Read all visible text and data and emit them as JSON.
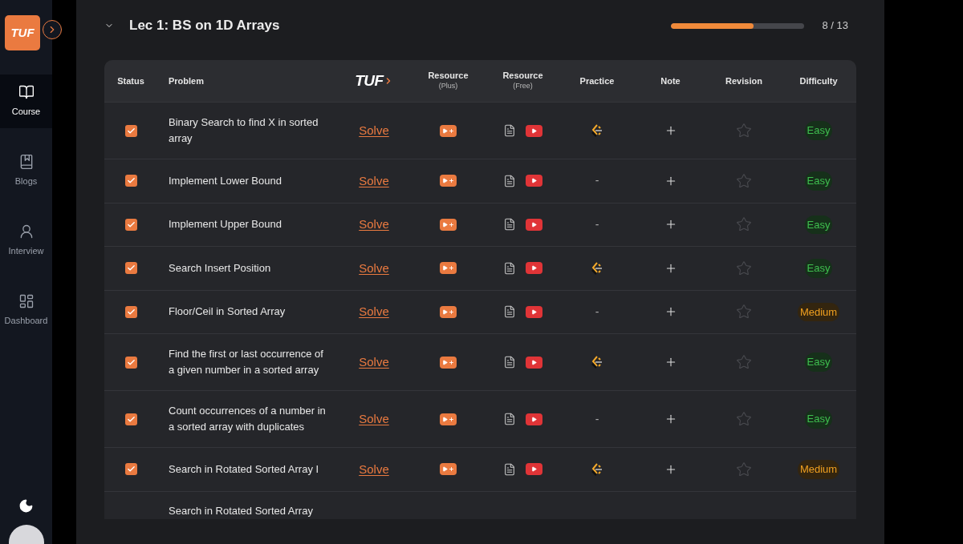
{
  "sidebar": {
    "logo": "TUF",
    "items": [
      {
        "label": "Course",
        "selected": true
      },
      {
        "label": "Blogs",
        "selected": false
      },
      {
        "label": "Interview",
        "selected": false
      },
      {
        "label": "Dashboard",
        "selected": false
      }
    ]
  },
  "lecture": {
    "title": "Lec 1: BS on 1D Arrays",
    "expanded": true,
    "progress": {
      "level": 0.615,
      "reading": "8 / 13"
    }
  },
  "table": {
    "columns": [
      {
        "kind": "text",
        "label": "Status"
      },
      {
        "kind": "text",
        "label": "Problem"
      },
      {
        "kind": "logo",
        "label": "TUF"
      },
      {
        "kind": "text",
        "label": "Resource",
        "sub": "(Plus)"
      },
      {
        "kind": "text",
        "label": "Resource",
        "sub": "(Free)"
      },
      {
        "kind": "text",
        "label": "Practice"
      },
      {
        "kind": "text",
        "label": "Note"
      },
      {
        "kind": "text",
        "label": "Revision"
      },
      {
        "kind": "text",
        "label": "Difficulty"
      }
    ],
    "rows": [
      {
        "kind": "full",
        "checked": true,
        "title": "Binary Search to find X in sorted array",
        "link": "Solve",
        "practice": {
          "kind": "icon"
        },
        "starred": false,
        "difficulty": {
          "kind": "easy",
          "label": "Easy"
        }
      },
      {
        "kind": "full",
        "checked": true,
        "title": "Implement Lower Bound",
        "link": "Solve",
        "practice": {
          "kind": "dash",
          "label": "-"
        },
        "starred": false,
        "difficulty": {
          "kind": "easy",
          "label": "Easy"
        }
      },
      {
        "kind": "full",
        "checked": true,
        "title": "Implement Upper Bound",
        "link": "Solve",
        "practice": {
          "kind": "dash",
          "label": "-"
        },
        "starred": false,
        "difficulty": {
          "kind": "easy",
          "label": "Easy"
        }
      },
      {
        "kind": "full",
        "checked": true,
        "title": "Search Insert Position",
        "link": "Solve",
        "practice": {
          "kind": "icon"
        },
        "starred": false,
        "difficulty": {
          "kind": "easy",
          "label": "Easy"
        }
      },
      {
        "kind": "full",
        "checked": true,
        "title": "Floor/Ceil in Sorted Array",
        "link": "Solve",
        "practice": {
          "kind": "dash",
          "label": "-"
        },
        "starred": false,
        "difficulty": {
          "kind": "medium",
          "label": "Medium"
        }
      },
      {
        "kind": "full",
        "checked": true,
        "title": "Find the first or last occurrence of a given number in a sorted array",
        "link": "Solve",
        "practice": {
          "kind": "icon"
        },
        "starred": false,
        "difficulty": {
          "kind": "easy",
          "label": "Easy"
        }
      },
      {
        "kind": "full",
        "checked": true,
        "title": "Count occurrences of a number in a sorted array with duplicates",
        "link": "Solve",
        "practice": {
          "kind": "dash",
          "label": "-"
        },
        "starred": false,
        "difficulty": {
          "kind": "easy",
          "label": "Easy"
        }
      },
      {
        "kind": "full",
        "checked": true,
        "title": "Search in Rotated Sorted Array I",
        "link": "Solve",
        "practice": {
          "kind": "icon"
        },
        "starred": false,
        "difficulty": {
          "kind": "medium",
          "label": "Medium"
        }
      },
      {
        "kind": "cut",
        "title": "Search in Rotated Sorted Array"
      }
    ]
  }
}
